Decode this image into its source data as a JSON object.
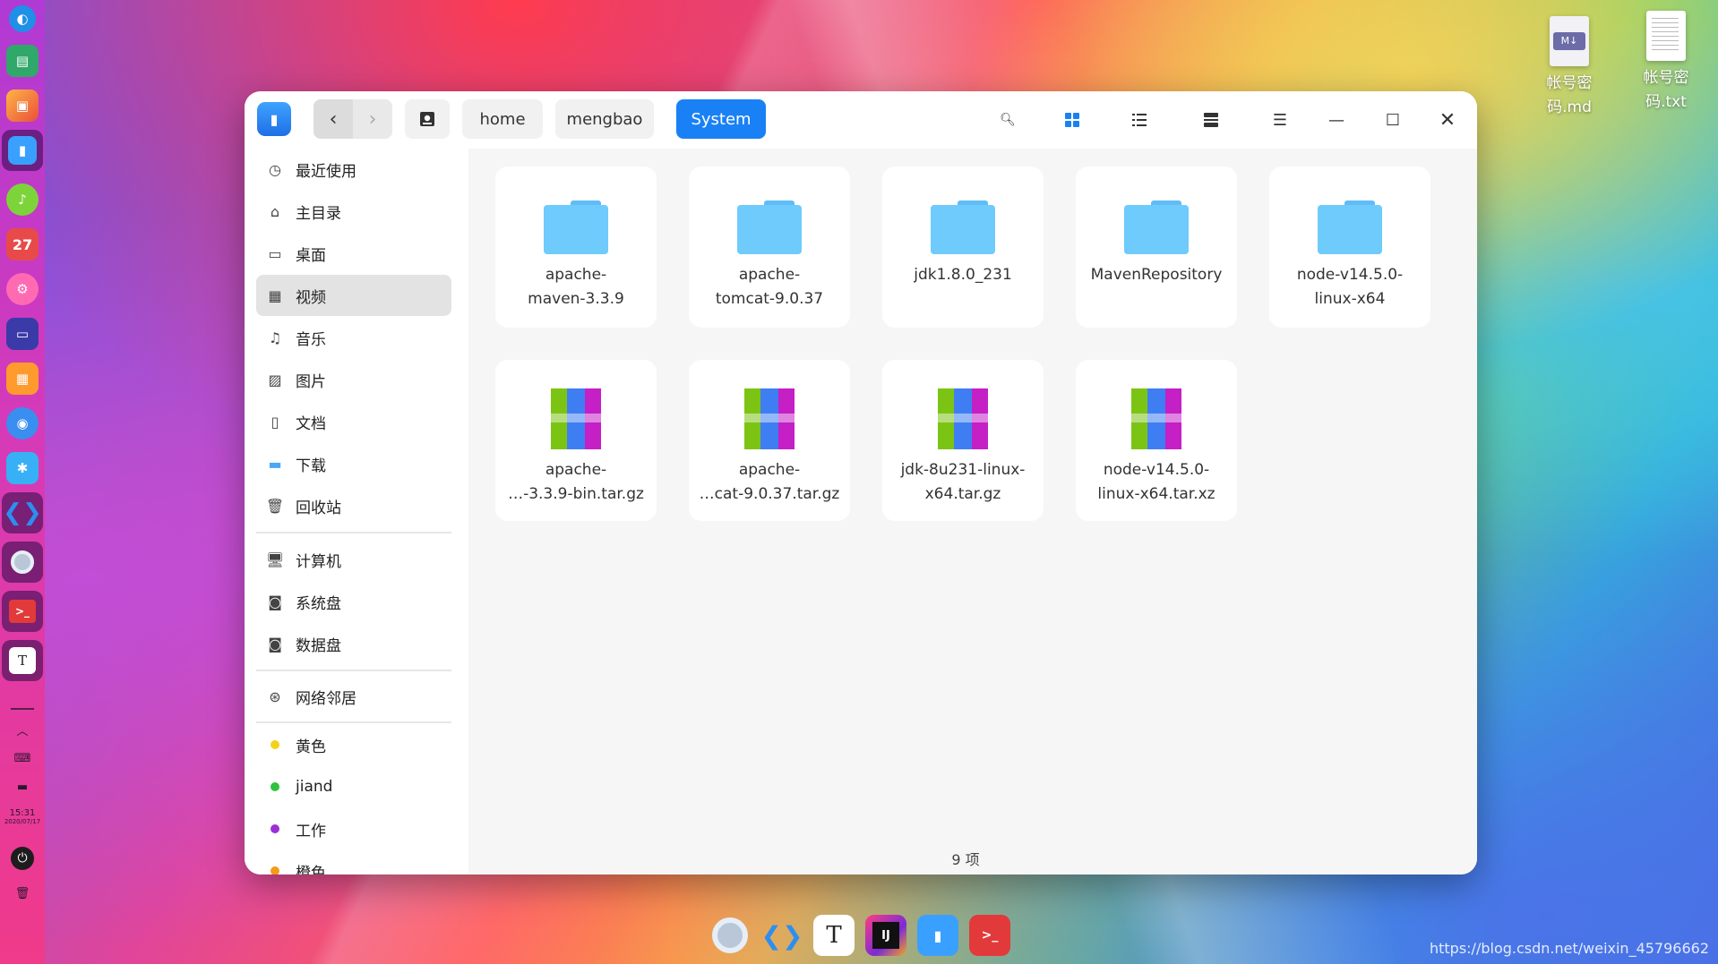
{
  "desktop": {
    "icons": [
      {
        "name": "帐号密码.md",
        "badge": "M↓"
      },
      {
        "name": "帐号密码.txt",
        "badge": ""
      }
    ]
  },
  "left_dock": {
    "calendar_day": "27",
    "clock_time": "15:31",
    "clock_date": "2020/07/17"
  },
  "titlebar": {
    "breadcrumbs": [
      "home",
      "mengbao",
      "System"
    ]
  },
  "sidebar": {
    "items": [
      {
        "label": "最近使用",
        "icon": "clock-icon"
      },
      {
        "label": "主目录",
        "icon": "home-icon"
      },
      {
        "label": "桌面",
        "icon": "desktop-icon"
      },
      {
        "label": "视频",
        "icon": "video-icon"
      },
      {
        "label": "音乐",
        "icon": "music-icon"
      },
      {
        "label": "图片",
        "icon": "picture-icon"
      },
      {
        "label": "文档",
        "icon": "document-icon"
      },
      {
        "label": "下载",
        "icon": "download-icon"
      },
      {
        "label": "回收站",
        "icon": "trash-icon"
      }
    ],
    "devices": [
      {
        "label": "计算机",
        "icon": "computer-icon"
      },
      {
        "label": "系统盘",
        "icon": "disk-icon"
      },
      {
        "label": "数据盘",
        "icon": "disk-icon"
      }
    ],
    "network": {
      "label": "网络邻居",
      "icon": "network-icon"
    },
    "tags": [
      {
        "label": "黄色",
        "color": "#f5d21a"
      },
      {
        "label": "jiand",
        "color": "#2fc23c"
      },
      {
        "label": "工作",
        "color": "#9c2fd6"
      },
      {
        "label": "橙色",
        "color": "#f59a1a"
      }
    ]
  },
  "files": {
    "folders": [
      {
        "label_line1": "apache-",
        "label_line2": "maven-3.3.9"
      },
      {
        "label_line1": "apache-",
        "label_line2": "tomcat-9.0.37"
      },
      {
        "label_line1": "jdk1.8.0_231",
        "label_line2": ""
      },
      {
        "label_line1": "MavenRepository",
        "label_line2": ""
      },
      {
        "label_line1": "node-v14.5.0-",
        "label_line2": "linux-x64"
      }
    ],
    "archives": [
      {
        "label_line1": "apache-",
        "label_line2": "…-3.3.9-bin.tar.gz"
      },
      {
        "label_line1": "apache-",
        "label_line2": "…cat-9.0.37.tar.gz"
      },
      {
        "label_line1": "jdk-8u231-linux-",
        "label_line2": "x64.tar.gz"
      },
      {
        "label_line1": "node-v14.5.0-",
        "label_line2": "linux-x64.tar.xz"
      }
    ]
  },
  "status": {
    "item_count": "9 项"
  },
  "colors": {
    "accent": "#1981f5",
    "folder": "#6ecbfb"
  },
  "watermark": "https://blog.csdn.net/weixin_45796662"
}
